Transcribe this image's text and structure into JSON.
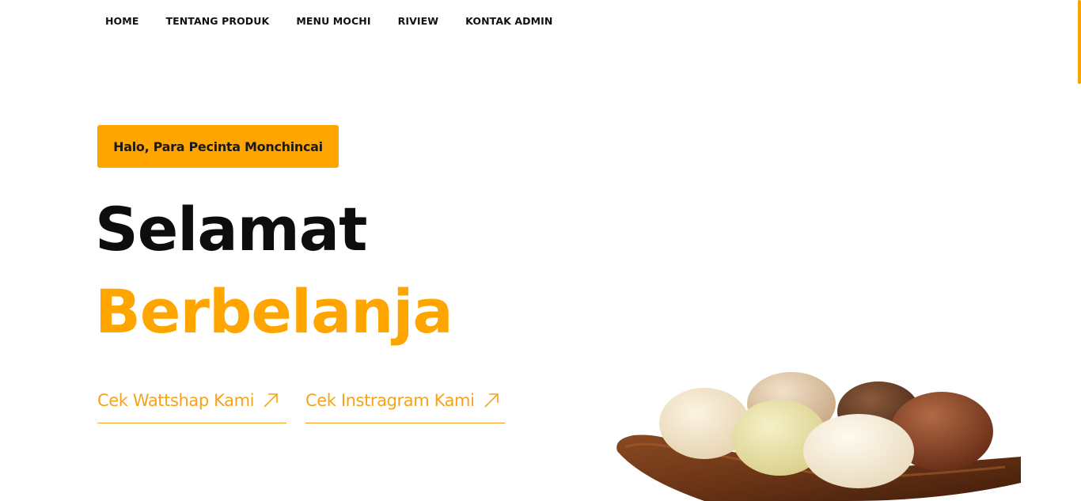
{
  "nav": {
    "items": [
      {
        "label": "HOME"
      },
      {
        "label": "TENTANG PRODUK"
      },
      {
        "label": "MENU MOCHI"
      },
      {
        "label": "RIVIEW"
      },
      {
        "label": "KONTAK ADMIN"
      }
    ]
  },
  "hero": {
    "badge": "Halo, Para Pecinta Monchincai",
    "title_line1": "Selamat",
    "title_line2": "Berbelanja",
    "cta_whatsapp": "Cek Wattshap Kami",
    "cta_instagram": "Cek Instragram Kami",
    "arrow_icon": "arrow-up-right-icon"
  },
  "colors": {
    "accent": "#ffa500",
    "text_dark": "#0d0d0d"
  }
}
